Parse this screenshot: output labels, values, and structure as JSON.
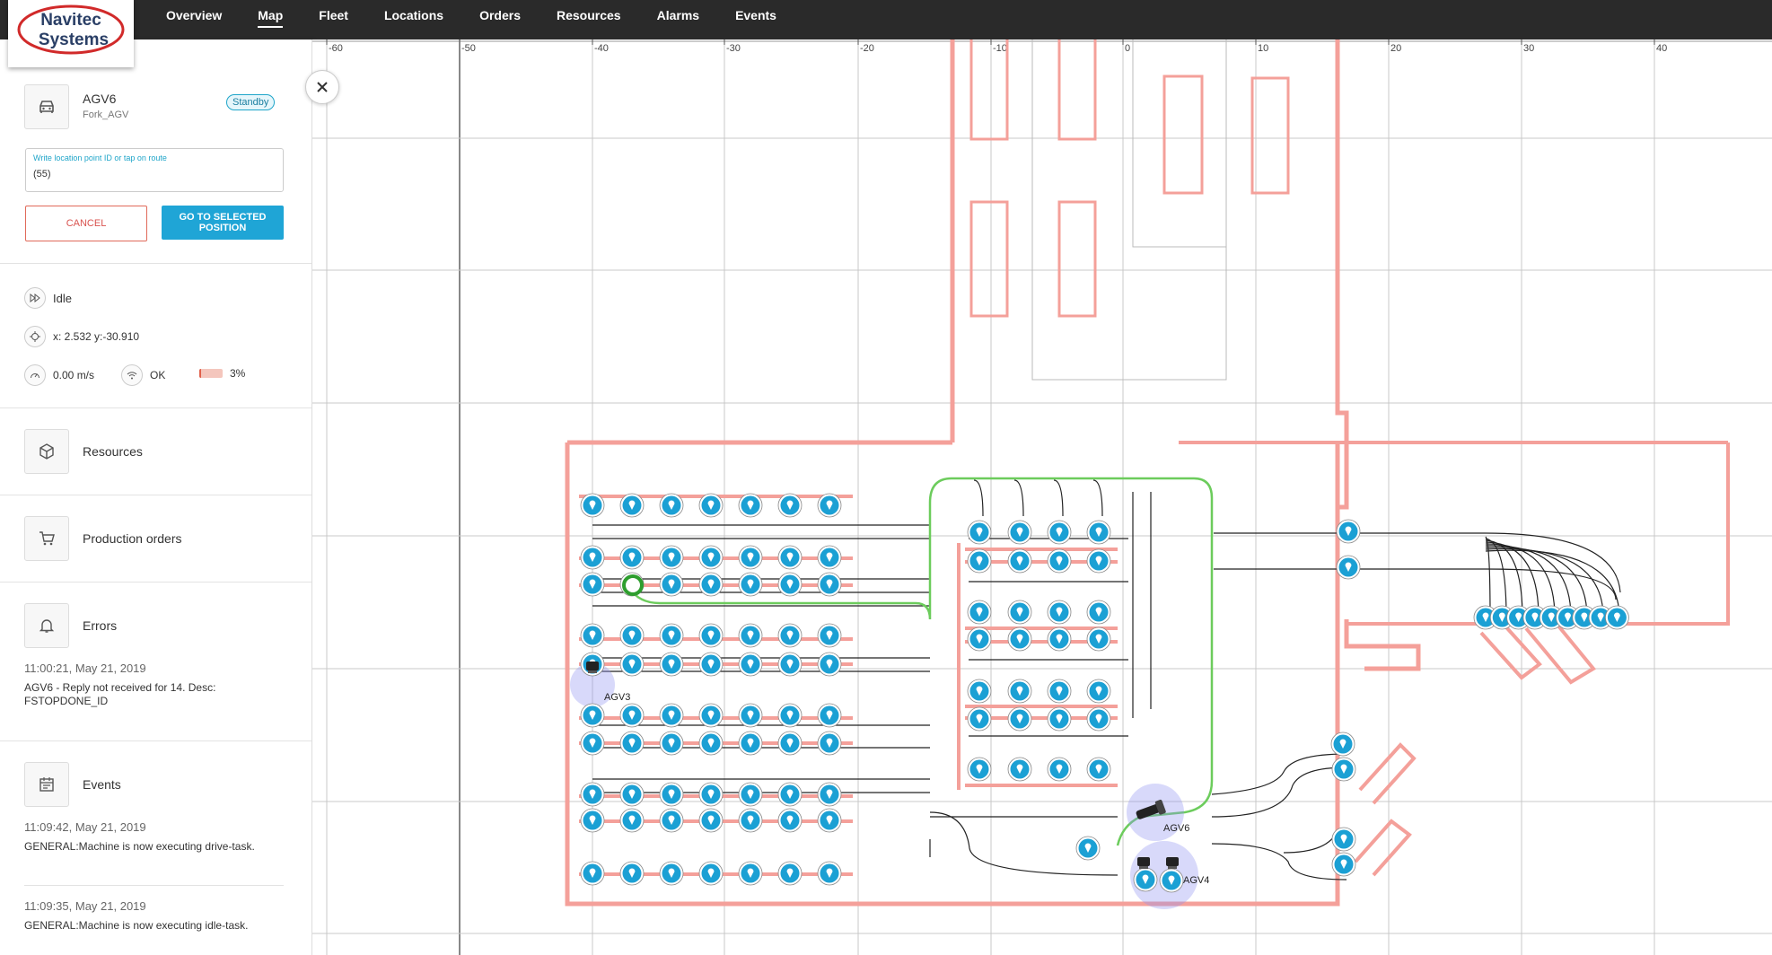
{
  "brand": {
    "line1": "Navitec",
    "line2": "Systems"
  },
  "nav": {
    "items": [
      "Overview",
      "Map",
      "Fleet",
      "Locations",
      "Orders",
      "Resources",
      "Alarms",
      "Events"
    ],
    "active": "Map"
  },
  "vehicle": {
    "name": "AGV6",
    "type": "Fork_AGV",
    "status": "Standby"
  },
  "location_input": {
    "label": "Write location point ID or tap on route",
    "value": "(55)"
  },
  "buttons": {
    "cancel": "CANCEL",
    "go": "GO TO SELECTED POSITION"
  },
  "state": {
    "mode": "Idle",
    "position": "x: 2.532 y:-30.910",
    "speed": "0.00 m/s",
    "connection": "OK",
    "battery": "3%",
    "battery_fraction": 0.03
  },
  "sections": {
    "resources": "Resources",
    "production_orders": "Production orders",
    "errors": "Errors",
    "events": "Events"
  },
  "errors": [
    {
      "time": "11:00:21, May 21, 2019",
      "message": "AGV6 - Reply not received for 14. Desc: FSTOPDONE_ID"
    }
  ],
  "events": [
    {
      "time": "11:09:42, May 21, 2019",
      "message": "GENERAL:Machine is now executing drive-task."
    },
    {
      "time": "11:09:35, May 21, 2019",
      "message": "GENERAL:Machine is now executing idle-task."
    }
  ],
  "map": {
    "axis_labels": [
      "-60",
      "-50",
      "-40",
      "-30",
      "-20",
      "-10",
      "0",
      "10",
      "20",
      "30",
      "40"
    ],
    "agv_labels": [
      "AGV3",
      "AGV6",
      "AGV4"
    ],
    "colors": {
      "walls": "#f4a09a",
      "pin": "#1ba0d4",
      "route": "#6ccc5c",
      "agv_halo": "#8f92f0",
      "paths": "#222222"
    }
  }
}
